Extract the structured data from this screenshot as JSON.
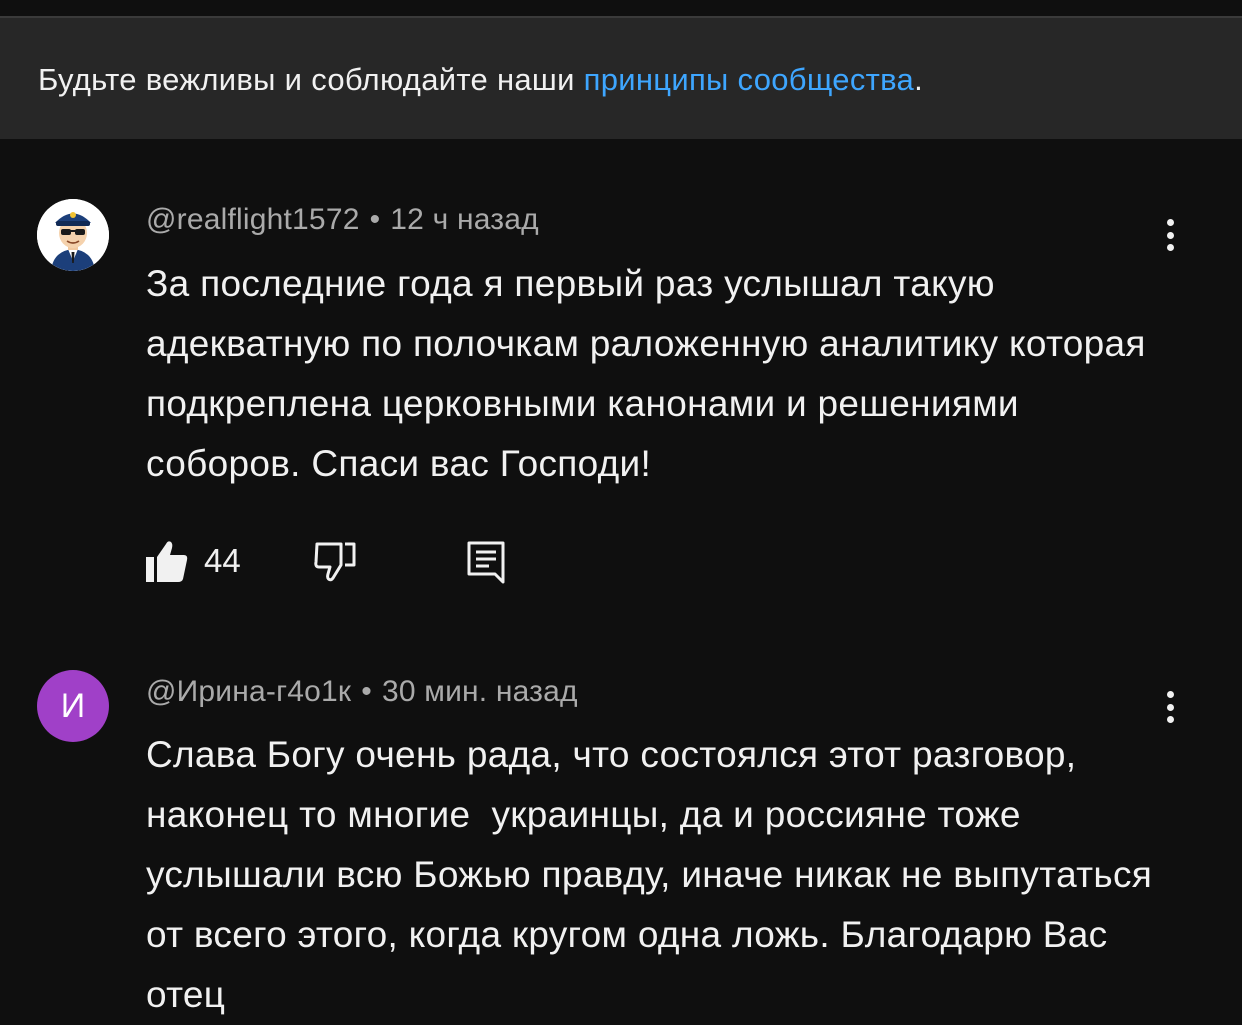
{
  "notice": {
    "text_before": "Будьте вежливы и соблюдайте наши ",
    "link_text": "принципы сообщества",
    "text_after": "."
  },
  "comments": [
    {
      "author": "@realflight1572",
      "separator": "•",
      "time": "12 ч назад",
      "text": "За последние года я первый раз услышал такую адекватную по полочкам раложенную аналитику которая подкреплена церковными канонами и решениями соборов. Спаси вас Господи!",
      "likes": "44",
      "avatar_icon": "pilot-avatar"
    },
    {
      "author": "@Ирина-г4о1к",
      "separator": "•",
      "time": "30 мин. назад",
      "text": "Слава Богу очень рада, что состоялся этот разговор, наконец то многие  украинцы, да и россияне тоже услышали всю Божью правду, иначе никак не выпутаться от всего этого, когда кругом одна ложь. Благодарю Вас отец",
      "avatar_letter": "И",
      "avatar_color": "#a040c8"
    }
  ],
  "colors": {
    "background": "#0f0f0f",
    "notice_bg": "#272727",
    "link": "#3ea6ff",
    "secondary_text": "#aaaaaa"
  }
}
